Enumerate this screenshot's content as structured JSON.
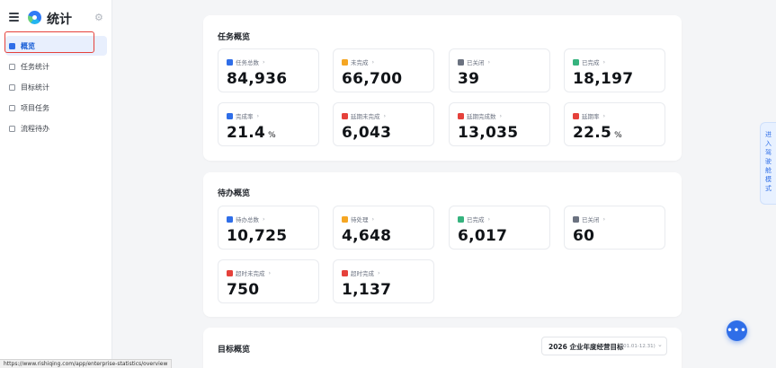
{
  "app": {
    "title": "统计"
  },
  "colors": {
    "accent": "#2f6ee8",
    "orange": "#f5a623",
    "gray": "#6b7280",
    "green": "#36b37e",
    "red": "#e5413b"
  },
  "sidebar": {
    "items": [
      {
        "label": "概览",
        "active": true
      },
      {
        "label": "任务统计"
      },
      {
        "label": "目标统计"
      },
      {
        "label": "项目任务"
      },
      {
        "label": "流程待办"
      }
    ]
  },
  "task_overview": {
    "title": "任务概览",
    "tiles": [
      {
        "label": "任务总数",
        "value": "84,936",
        "icon": "task-total-icon",
        "color": "#2f6ee8"
      },
      {
        "label": "未完成",
        "value": "66,700",
        "icon": "incomplete-icon",
        "color": "#f5a623"
      },
      {
        "label": "已关闭",
        "value": "39",
        "icon": "closed-icon",
        "color": "#6b7280"
      },
      {
        "label": "已完成",
        "value": "18,197",
        "icon": "completed-icon",
        "color": "#36b37e"
      },
      {
        "label": "完成率",
        "value": "21.4",
        "unit": "%",
        "icon": "completion-rate-icon",
        "color": "#2f6ee8"
      },
      {
        "label": "延期未完成",
        "value": "6,043",
        "icon": "overdue-incomplete-icon",
        "color": "#e5413b"
      },
      {
        "label": "延期完成数",
        "value": "13,035",
        "icon": "overdue-completed-icon",
        "color": "#e5413b"
      },
      {
        "label": "延期率",
        "value": "22.5",
        "unit": "%",
        "icon": "overdue-rate-icon",
        "color": "#e5413b"
      }
    ]
  },
  "todo_overview": {
    "title": "待办概览",
    "tiles": [
      {
        "label": "待办总数",
        "value": "10,725",
        "icon": "todo-total-icon",
        "color": "#2f6ee8"
      },
      {
        "label": "待处理",
        "value": "4,648",
        "icon": "pending-icon",
        "color": "#f5a623"
      },
      {
        "label": "已完成",
        "value": "6,017",
        "icon": "completed-icon",
        "color": "#36b37e"
      },
      {
        "label": "已关闭",
        "value": "60",
        "icon": "closed-icon",
        "color": "#6b7280"
      },
      {
        "label": "超时未完成",
        "value": "750",
        "icon": "timeout-incomplete-icon",
        "color": "#e5413b"
      },
      {
        "label": "超时完成",
        "value": "1,137",
        "icon": "timeout-completed-icon",
        "color": "#e5413b"
      }
    ]
  },
  "goal_overview": {
    "title": "目标概览",
    "select_value": "2026 企业年度经营目标",
    "select_range": "(01.01-12.31)"
  },
  "right_tab": {
    "label": "进入驾驶舱模式"
  },
  "status_url": "https://www.rishiqing.com/app/enterprise-statistics/overview"
}
